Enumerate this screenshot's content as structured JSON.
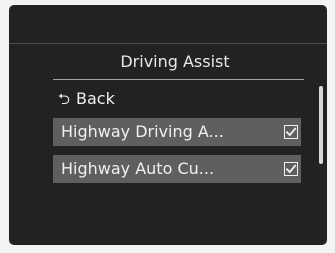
{
  "menu": {
    "title": "Driving Assist",
    "back_icon": "return-arrow-icon",
    "back_label": "Back",
    "items": [
      {
        "label": "Highway Driving A...",
        "checked": true,
        "icon": "checked-box-icon"
      },
      {
        "label": "Highway Auto Cu...",
        "checked": true,
        "icon": "checked-box-icon"
      }
    ]
  },
  "scrollbar": {
    "visible": true
  },
  "colors": {
    "screen_background": "#222222",
    "selected_row": "#5f5f5f",
    "text": "#f0f0f0"
  }
}
